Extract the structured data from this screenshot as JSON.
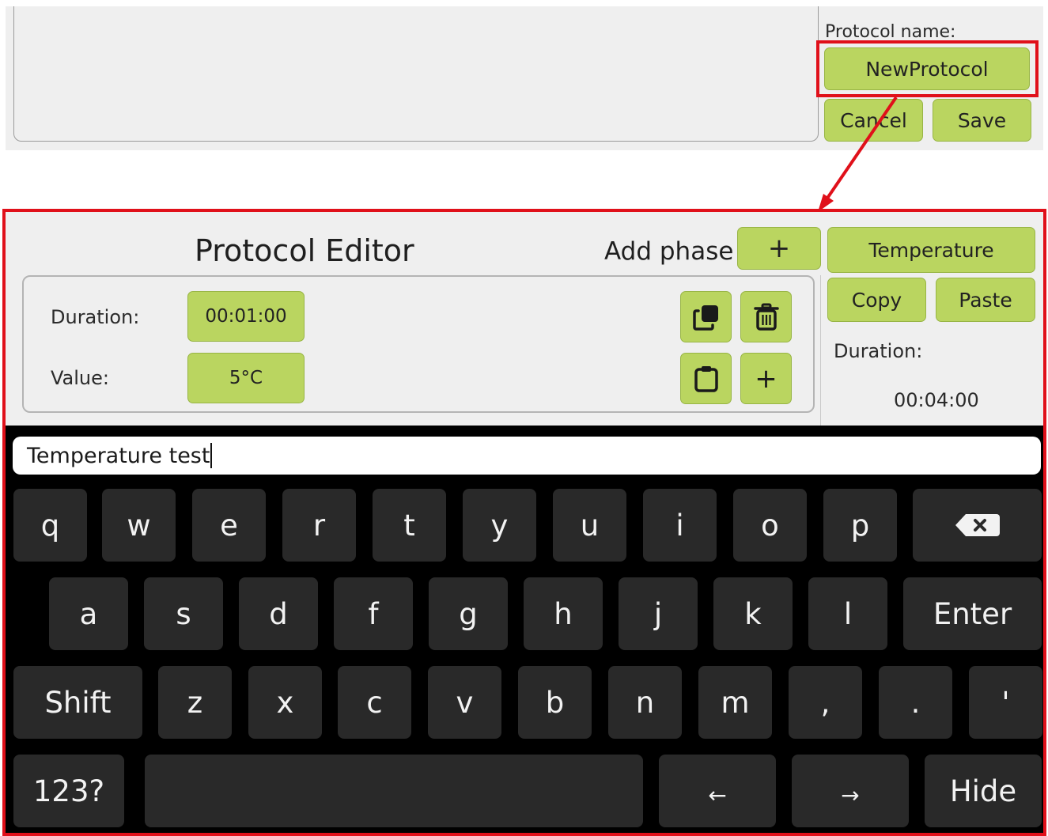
{
  "top": {
    "protocol_name_label": "Protocol name:",
    "protocol_name_value": "NewProtocol",
    "cancel_label": "Cancel",
    "save_label": "Save"
  },
  "editor": {
    "title": "Protocol Editor",
    "add_phase_label": "Add phase",
    "add_phase_button": "+",
    "phase": {
      "duration_label": "Duration:",
      "duration_value": "00:01:00",
      "value_label": "Value:",
      "value_value": "5°C"
    },
    "side": {
      "type_button": "Temperature",
      "copy_label": "Copy",
      "paste_label": "Paste",
      "duration_label": "Duration:",
      "duration_value": "00:04:00"
    },
    "icons": {
      "duplicate": "duplicate-icon",
      "delete": "trash-icon",
      "paste": "clipboard-icon",
      "add": "plus-icon"
    }
  },
  "keyboard": {
    "input_text": "Temperature test",
    "row1": [
      "q",
      "w",
      "e",
      "r",
      "t",
      "y",
      "u",
      "i",
      "o",
      "p"
    ],
    "row2": [
      "a",
      "s",
      "d",
      "f",
      "g",
      "h",
      "j",
      "k",
      "l"
    ],
    "row3": [
      "z",
      "x",
      "c",
      "v",
      "b",
      "n",
      "m",
      ",",
      ".",
      "'"
    ],
    "enter_label": "Enter",
    "shift_label": "Shift",
    "numbers_label": "123?",
    "left_label": "←",
    "right_label": "→",
    "hide_label": "Hide",
    "backspace_icon": "backspace-icon"
  },
  "colors": {
    "accent_green": "#bad560",
    "highlight_red": "#e0101a",
    "key_bg": "#292929"
  }
}
